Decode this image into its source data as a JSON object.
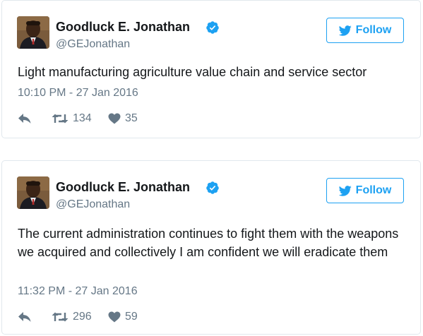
{
  "colors": {
    "accent": "#1da1f2",
    "secondary_text": "#657786",
    "border": "#e1e8ed"
  },
  "tweets": [
    {
      "author_name": "Goodluck E. Jonathan",
      "handle": "@GEJonathan",
      "verified_icon": "verified-badge-icon",
      "follow_label": "Follow",
      "text": "Light manufacturing agriculture value chain and service sector",
      "timestamp": "10:10 PM - 27 Jan 2016",
      "retweets": "134",
      "likes": "35"
    },
    {
      "author_name": "Goodluck E. Jonathan",
      "handle": "@GEJonathan",
      "verified_icon": "verified-badge-icon",
      "follow_label": "Follow",
      "text": "The current administration continues to fight them with the weapons we acquired and collectively I am confident we will eradicate them",
      "timestamp": "11:32 PM - 27 Jan 2016",
      "retweets": "296",
      "likes": "59"
    }
  ]
}
